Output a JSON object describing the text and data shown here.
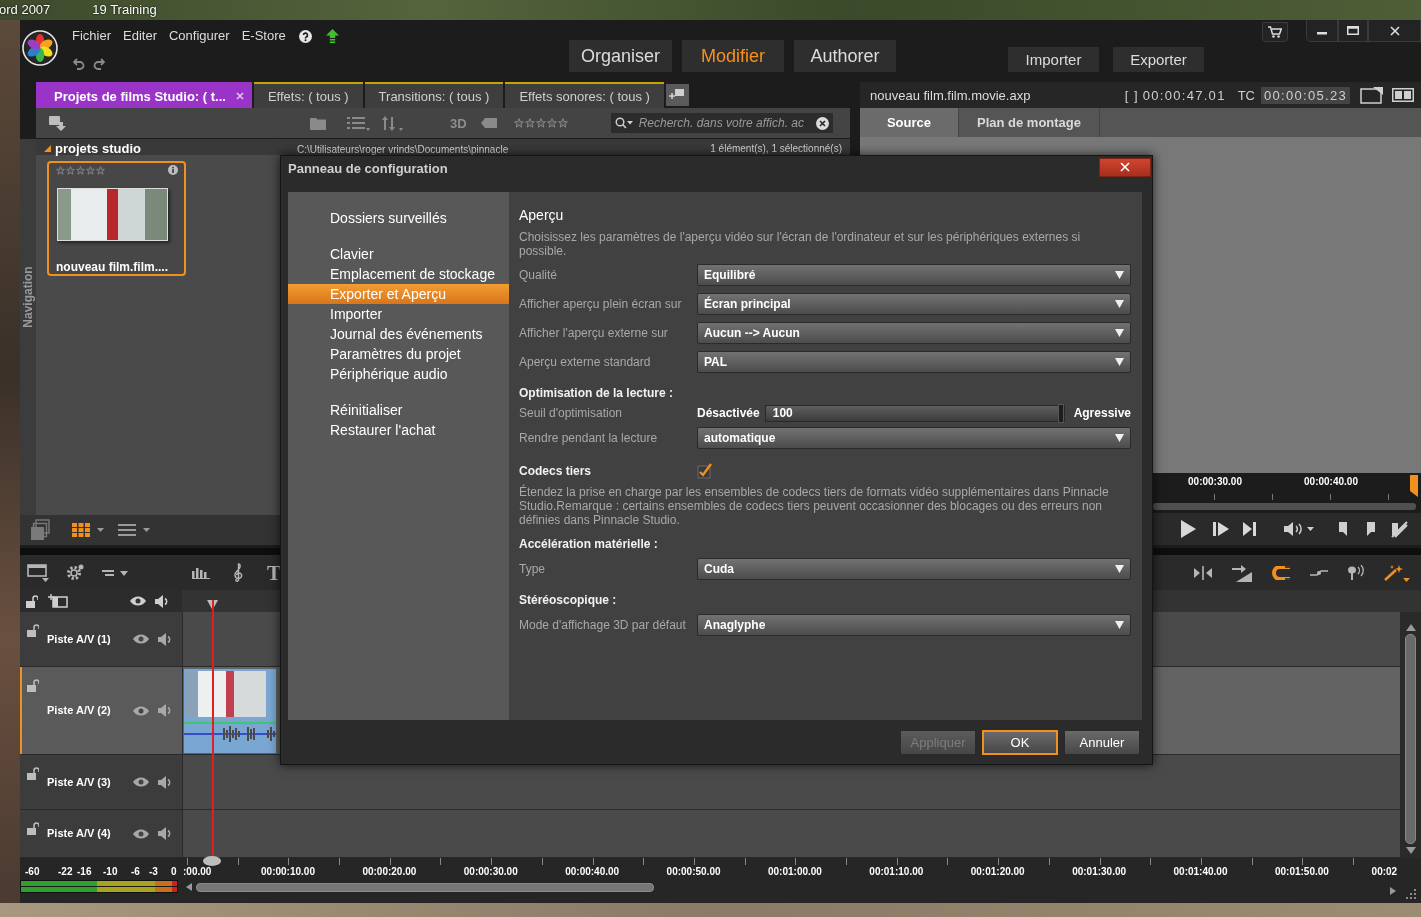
{
  "desktop": {
    "icon_labels": [
      "ord 2007",
      "19 Training"
    ]
  },
  "menu": {
    "items": [
      "Fichier",
      "Editer",
      "Configurer",
      "E-Store"
    ]
  },
  "modes": [
    {
      "label": "Organiser",
      "selected": false
    },
    {
      "label": "Modifier",
      "selected": true
    },
    {
      "label": "Authorer",
      "selected": false
    }
  ],
  "actions": [
    "Importer",
    "Exporter"
  ],
  "library": {
    "tabs": [
      {
        "label": "Projets de films Studio: ( t...",
        "selected": true
      },
      {
        "label": "Effets: ( tous )",
        "selected": false
      },
      {
        "label": "Transitions: ( tous )",
        "selected": false
      },
      {
        "label": "Effets sonores: ( tous )",
        "selected": false
      }
    ],
    "toolbar": {
      "stereo_label": "3D",
      "rating_filter": {
        "stars": 0
      },
      "search_placeholder": "Recherch. dans votre affich. ac"
    },
    "navigation_label": "Navigation",
    "folder": {
      "name": "projets studio",
      "expanded": true,
      "path": "C:\\Utilisateurs\\roger vrinds\\Documents\\pinnacle",
      "count": "1 élément(s), 1 sélectionné(s)"
    },
    "items": [
      {
        "title": "nouveau film.film....",
        "selected": true,
        "stars": 0
      }
    ],
    "views": [
      {
        "kind": "grid",
        "selected": true
      },
      {
        "kind": "list",
        "selected": false
      }
    ]
  },
  "player": {
    "file": "nouveau film.film.movie.axp",
    "duration_label": "[ ]",
    "duration": "00:00:47.01",
    "tc_label": "TC",
    "timecode": "00:00:05.23",
    "tabs": [
      {
        "label": "Source",
        "selected": true
      },
      {
        "label": "Plan de montage",
        "selected": false
      }
    ],
    "ruler": [
      "00:00:30.00",
      "00:00:40.00"
    ]
  },
  "timeline": {
    "title_tool": "T",
    "snap_on": true,
    "tracks": [
      {
        "name": "Piste A/V (1)",
        "selected": false,
        "has_clip": false
      },
      {
        "name": "Piste A/V (2)",
        "selected": true,
        "has_clip": true
      },
      {
        "name": "Piste A/V (3)",
        "selected": false,
        "has_clip": false
      },
      {
        "name": "Piste A/V (4)",
        "selected": false,
        "has_clip": false
      }
    ],
    "meter_scale": [
      "-60",
      "-22",
      "-16",
      "-10",
      "-6",
      "-3",
      "0"
    ],
    "ruler": [
      ":00.00",
      "00:00:10.00",
      "00:00:20.00",
      "00:00:30.00",
      "00:00:40.00",
      "00:00:50.00",
      "00:01:00.00",
      "00:01:10.00",
      "00:01:20.00",
      "00:01:30.00",
      "00:01:40.00",
      "00:01:50.00",
      "00:02"
    ]
  },
  "dialog": {
    "title": "Panneau de configuration",
    "nav_groups": [
      {
        "items": [
          {
            "label": "Dossiers surveillés",
            "selected": false
          }
        ]
      },
      {
        "items": [
          {
            "label": "Clavier",
            "selected": false
          },
          {
            "label": "Emplacement de stockage",
            "selected": false
          },
          {
            "label": "Exporter et Aperçu",
            "selected": true
          },
          {
            "label": "Importer",
            "selected": false
          },
          {
            "label": "Journal des événements",
            "selected": false
          },
          {
            "label": "Paramètres du projet",
            "selected": false
          },
          {
            "label": "Périphérique audio",
            "selected": false
          }
        ]
      },
      {
        "items": [
          {
            "label": "Réinitialiser",
            "selected": false
          },
          {
            "label": "Restaurer l'achat",
            "selected": false
          }
        ]
      }
    ],
    "heading": "Aperçu",
    "description": "Choisissez les paramètres de l'aperçu vidéo sur l'écran de l'ordinateur et sur les périphériques externes si possible.",
    "settings": [
      {
        "kind": "dropdown",
        "label": "Qualité",
        "value": "Equilibré"
      },
      {
        "kind": "dropdown",
        "label": "Afficher aperçu plein écran sur",
        "value": "Écran principal"
      },
      {
        "kind": "dropdown",
        "label": "Afficher l'aperçu externe sur",
        "value": "Aucun --> Aucun"
      },
      {
        "kind": "dropdown",
        "label": "Aperçu externe standard",
        "value": "PAL"
      },
      {
        "kind": "section",
        "label": "Optimisation de la lecture :"
      },
      {
        "kind": "slider",
        "label": "Seuil d'optimisation",
        "min_label": "Désactivée",
        "value": "100",
        "max_label": "Agressive",
        "level": 1
      },
      {
        "kind": "dropdown",
        "label": "Rendre pendant la lecture",
        "value": "automatique"
      },
      {
        "kind": "checkbox",
        "label": "Codecs tiers",
        "checked": true
      },
      {
        "kind": "note",
        "text": "Étendez la prise en charge par les ensembles de codecs tiers de formats vidéo supplémentaires dans Pinnacle Studio.Remarque : certains ensembles de codecs tiers peuvent occasionner des blocages ou des erreurs non définies dans Pinnacle Studio."
      },
      {
        "kind": "section",
        "label": "Accélération matérielle :"
      },
      {
        "kind": "dropdown",
        "label": "Type",
        "value": "Cuda"
      },
      {
        "kind": "section",
        "label": "Stéréoscopique :"
      },
      {
        "kind": "dropdown",
        "label": "Mode d'affichage 3D par défaut",
        "value": "Anaglyphe"
      }
    ],
    "buttons": [
      {
        "label": "Appliquer",
        "disabled": true,
        "default": false
      },
      {
        "label": "OK",
        "disabled": false,
        "default": true
      },
      {
        "label": "Annuler",
        "disabled": false,
        "default": false
      }
    ]
  }
}
